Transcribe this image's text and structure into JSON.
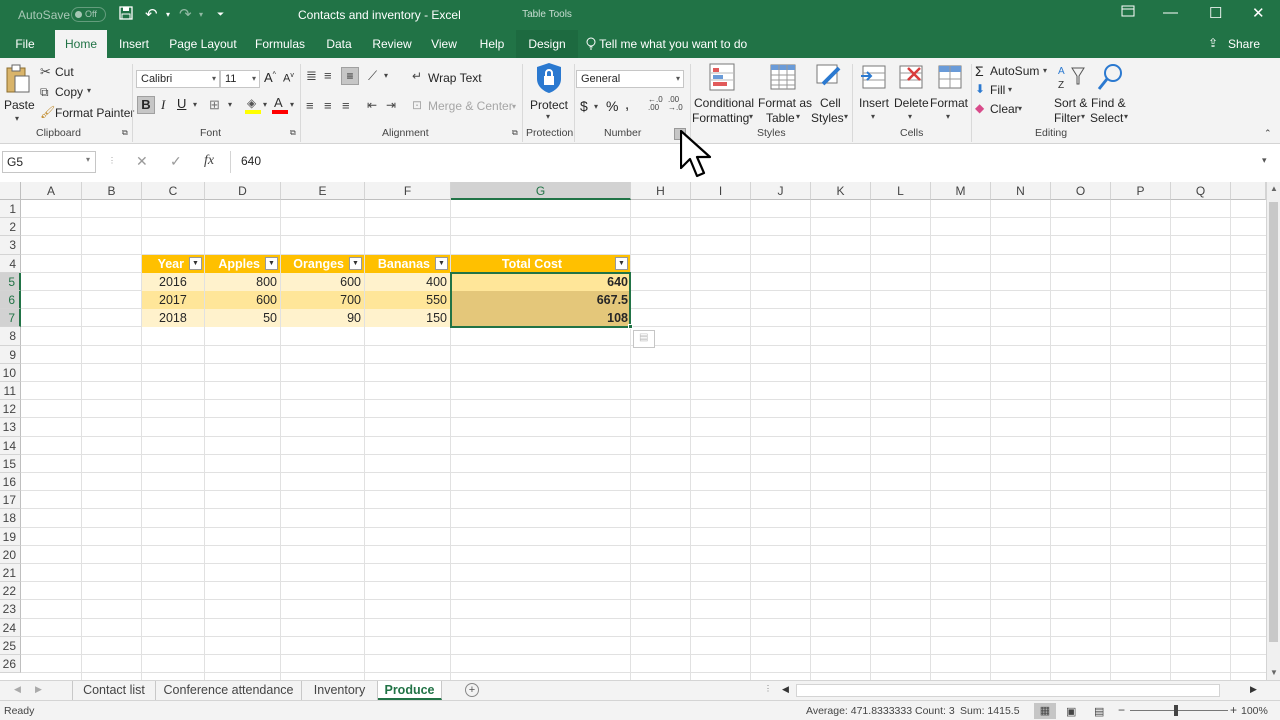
{
  "titlebar": {
    "autosave_label": "AutoSave",
    "autosave_state": "Off",
    "doc_title": "Contacts and inventory  -  Excel",
    "context_tab": "Table Tools"
  },
  "tabs": [
    "File",
    "Home",
    "Insert",
    "Page Layout",
    "Formulas",
    "Data",
    "Review",
    "View",
    "Help",
    "Design"
  ],
  "tell_me": "Tell me what you want to do",
  "share": "Share",
  "ribbon": {
    "clipboard": {
      "paste": "Paste",
      "cut": "Cut",
      "copy": "Copy",
      "format_painter": "Format Painter",
      "label": "Clipboard"
    },
    "font": {
      "name": "Calibri",
      "size": "11",
      "label": "Font"
    },
    "alignment": {
      "wrap_text": "Wrap Text",
      "merge_center": "Merge & Center",
      "label": "Alignment"
    },
    "protection": {
      "protect": "Protect",
      "label": "Protection"
    },
    "number": {
      "format": "General",
      "label": "Number"
    },
    "styles": {
      "conditional_1": "Conditional",
      "conditional_2": "Formatting",
      "format_as_1": "Format as",
      "format_as_2": "Table",
      "cell_styles_1": "Cell",
      "cell_styles_2": "Styles",
      "label": "Styles"
    },
    "cells": {
      "insert": "Insert",
      "delete": "Delete",
      "format": "Format",
      "label": "Cells"
    },
    "editing": {
      "autosum": "AutoSum",
      "fill": "Fill",
      "clear": "Clear",
      "sort_1": "Sort &",
      "sort_2": "Filter",
      "find_1": "Find &",
      "find_2": "Select",
      "label": "Editing"
    }
  },
  "formula_bar": {
    "name_box": "G5",
    "value": "640"
  },
  "columns": [
    "A",
    "B",
    "C",
    "D",
    "E",
    "F",
    "G",
    "H",
    "I",
    "J",
    "K",
    "L",
    "M",
    "N",
    "O",
    "P",
    "Q"
  ],
  "rows": [
    "1",
    "2",
    "3",
    "4",
    "5",
    "6",
    "7",
    "8",
    "9",
    "10",
    "11",
    "12",
    "13",
    "14",
    "15",
    "16",
    "17",
    "18",
    "19",
    "20",
    "21",
    "22",
    "23",
    "24",
    "25",
    "26"
  ],
  "table": {
    "headers": [
      "Year",
      "Apples",
      "Oranges",
      "Bananas",
      "Total Cost"
    ],
    "rows": [
      [
        "2016",
        "800",
        "600",
        "400",
        "640"
      ],
      [
        "2017",
        "600",
        "700",
        "550",
        "667.5"
      ],
      [
        "2018",
        "50",
        "90",
        "150",
        "108"
      ]
    ]
  },
  "sheets": [
    "Contact list",
    "Conference attendance",
    "Inventory",
    "Produce"
  ],
  "active_sheet": "Produce",
  "status": {
    "ready": "Ready",
    "average": "Average: 471.8333333",
    "count": "Count: 3",
    "sum": "Sum: 1415.5",
    "zoom": "100%"
  },
  "colors": {
    "excel_green": "#217346",
    "table_header": "#ffc000",
    "band_light": "#fff2cc",
    "band_dark": "#ffe699"
  }
}
